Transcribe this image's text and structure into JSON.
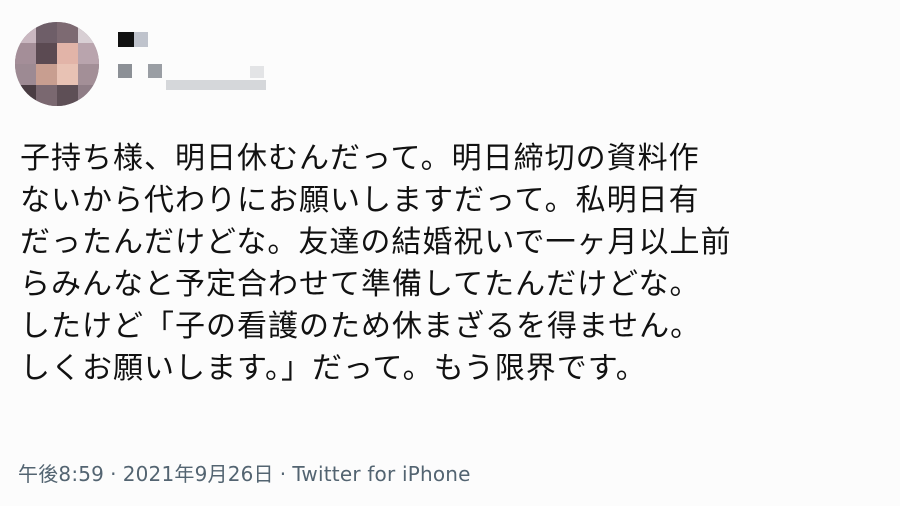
{
  "tweet": {
    "text_lines": [
      "子持ち様、明日休むんだって。明日締切の資料作",
      "ないから代わりにお願いしますだって。私明日有",
      "だったんだけどな。友達の結婚祝いで一ヶ月以上前",
      "らみんなと予定合わせて準備してたんだけどな。",
      "したけど「子の看護のため休まざるを得ません。",
      "しくお願いします。」だって。もう限界です。"
    ],
    "time": "午後8:59",
    "separator": "·",
    "date": "2021年9月26日",
    "source": "Twitter for iPhone"
  },
  "colors": {
    "text": "#111111",
    "meta": "#536471",
    "background": "#fcfcfc"
  }
}
